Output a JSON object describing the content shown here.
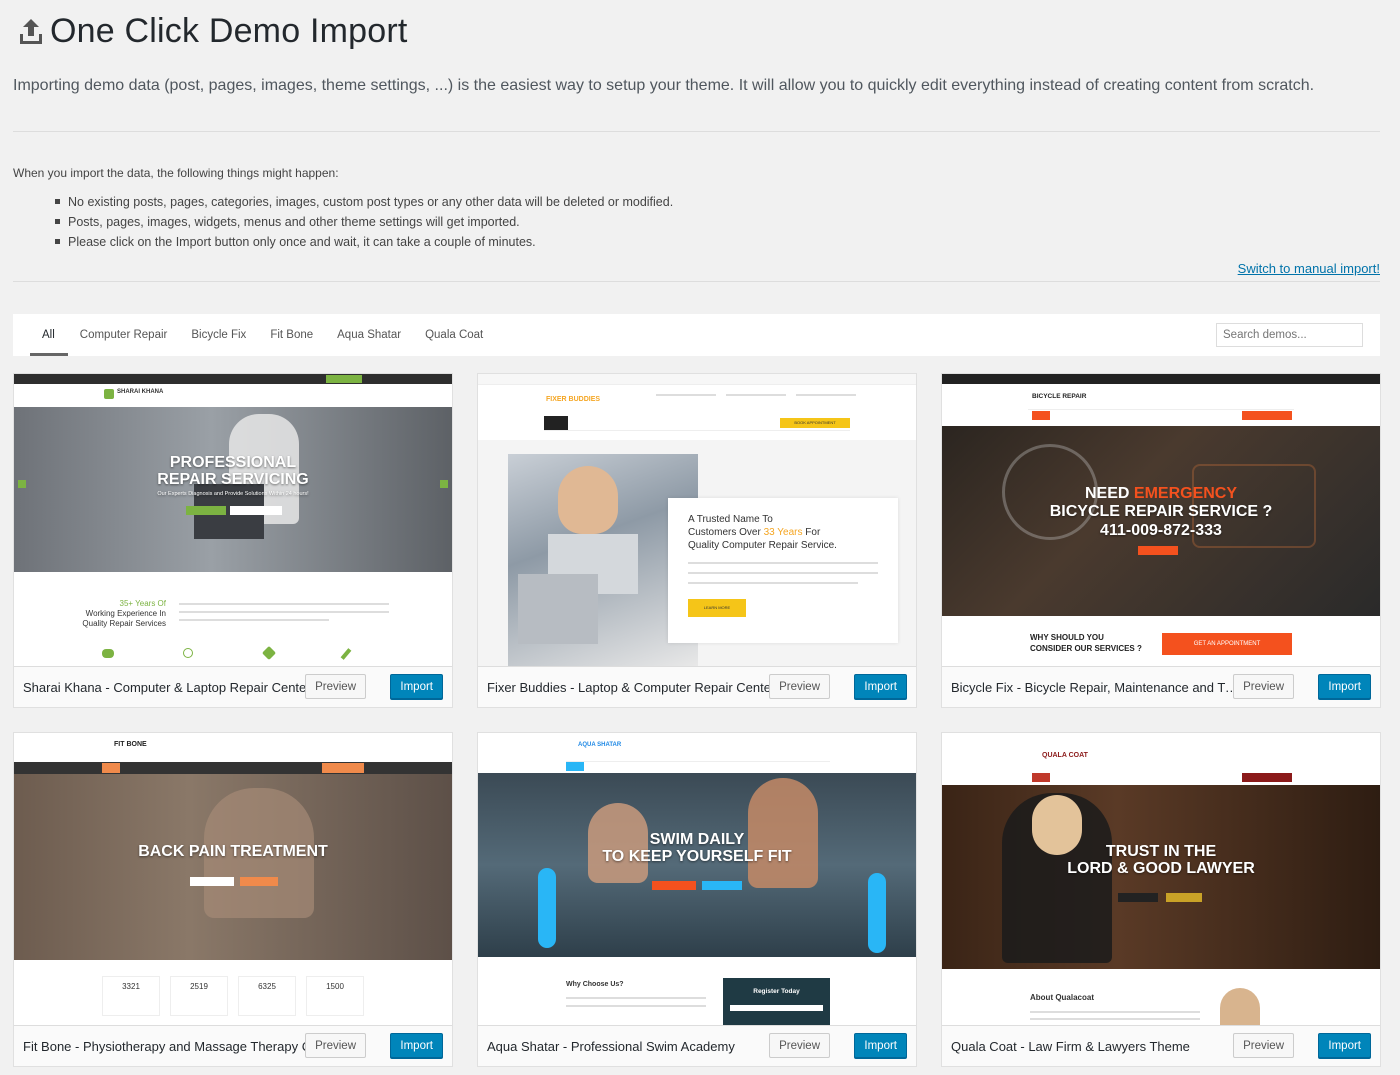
{
  "header": {
    "title": "One Click Demo Import",
    "intro": "Importing demo data (post, pages, images, theme settings, ...) is the easiest way to setup your theme. It will allow you to quickly edit everything instead of creating content from scratch."
  },
  "notice": {
    "lead": "When you import the data, the following things might happen:",
    "items": [
      "No existing posts, pages, categories, images, custom post types or any other data will be deleted or modified.",
      "Posts, pages, images, widgets, menus and other theme settings will get imported.",
      "Please click on the Import button only once and wait, it can take a couple of minutes."
    ],
    "manual_link": "Switch to manual import!"
  },
  "filters": {
    "tabs": [
      "All",
      "Computer Repair",
      "Bicycle Fix",
      "Fit Bone",
      "Aqua Shatar",
      "Quala Coat"
    ],
    "active": "All",
    "search_placeholder": "Search demos..."
  },
  "buttons": {
    "preview": "Preview",
    "import": "Import"
  },
  "demos": [
    {
      "name": "Sharai Khana - Computer & Laptop Repair Center",
      "thumb": {
        "brand": "SHARAI KHANA",
        "hero_line1": "PROFESSIONAL",
        "hero_line2": "REPAIR SERVICING",
        "hero_sub": "Our Experts Diagnosis and Provide Solutions Within 24 hours!",
        "stat": "35+ Years Of",
        "stat2": "Working Experience In",
        "stat3": "Quality Repair Services"
      }
    },
    {
      "name": "Fixer Buddies - Laptop & Computer Repair Center",
      "thumb": {
        "brand": "FIXER BUDDIES",
        "cta": "BOOK APPOINTMENT",
        "h1": "A Trusted Name To",
        "h2a": "Customers Over ",
        "h2b": "33 Years",
        "h2c": " For",
        "h3": "Quality Computer Repair Service.",
        "btn": "LEARN MORE"
      }
    },
    {
      "name": "Bicycle Fix - Bicycle Repair, Maintenance and Tune-...",
      "thumb": {
        "brand": "BICYCLE REPAIR",
        "l1a": "NEED ",
        "l1b": "EMERGENCY",
        "l2": "BICYCLE REPAIR SERVICE ?",
        "l3": "411-009-872-333",
        "why1": "WHY SHOULD YOU",
        "why2": "CONSIDER OUR SERVICES ?",
        "cta": "GET AN APPOINTMENT"
      }
    },
    {
      "name": "Fit Bone - Physiotherapy and Massage Therapy Center",
      "thumb": {
        "brand": "FIT BONE",
        "hero": "BACK PAIN TREATMENT",
        "stats": [
          "3321",
          "2519",
          "6325",
          "1500"
        ]
      }
    },
    {
      "name": "Aqua Shatar - Professional Swim Academy",
      "thumb": {
        "brand": "AQUA SHATAR",
        "l1": "SWIM DAILY",
        "l2": "TO KEEP YOURSELF FIT",
        "why": "Why Choose Us?",
        "reg": "Register Today"
      }
    },
    {
      "name": "Quala Coat - Law Firm & Lawyers Theme",
      "thumb": {
        "brand": "QUALA COAT",
        "l1": "TRUST IN THE",
        "l2": "LORD & GOOD LAWYER",
        "about": "About Qualacoat"
      }
    }
  ],
  "colors": {
    "import_blue": "#0085ba",
    "link_blue": "#0073aa",
    "page_bg": "#f1f1f1"
  }
}
